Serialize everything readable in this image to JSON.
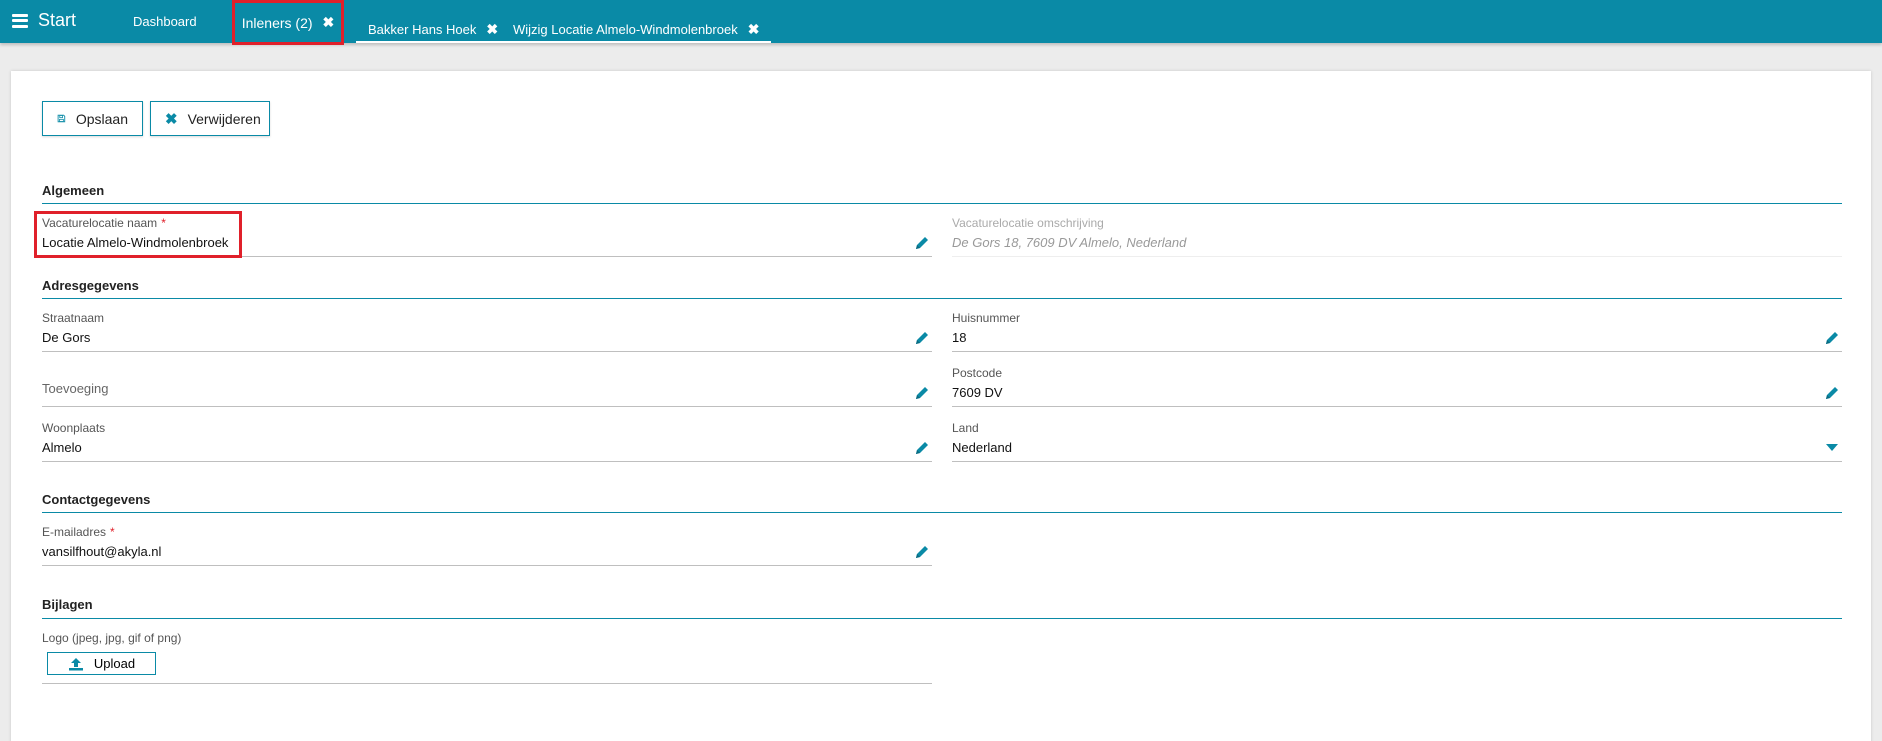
{
  "topbar": {
    "start_label": "Start",
    "tabs": [
      {
        "label": "Dashboard",
        "closable": false
      },
      {
        "label": "Inleners (2)",
        "closable": true
      },
      {
        "label": "Bakker Hans Hoek",
        "closable": true
      },
      {
        "label": "Wijzig Locatie Almelo-Windmolenbroek",
        "closable": true
      }
    ],
    "close_glyph": "✖"
  },
  "toolbar": {
    "save_label": "Opslaan",
    "delete_label": "Verwijderen"
  },
  "sections": {
    "algemeen": "Algemeen",
    "adres": "Adresgegevens",
    "contact": "Contactgegevens",
    "bijlagen": "Bijlagen"
  },
  "fields": {
    "naam": {
      "label": "Vacaturelocatie naam",
      "value": "Locatie Almelo-Windmolenbroek",
      "required": "*"
    },
    "omschrijving": {
      "label": "Vacaturelocatie omschrijving",
      "value": "De Gors 18, 7609 DV Almelo, Nederland"
    },
    "straatnaam": {
      "label": "Straatnaam",
      "value": "De Gors"
    },
    "huisnummer": {
      "label": "Huisnummer",
      "value": "18"
    },
    "toevoeging": {
      "label": "Toevoeging",
      "value": ""
    },
    "postcode": {
      "label": "Postcode",
      "value": "7609 DV"
    },
    "woonplaats": {
      "label": "Woonplaats",
      "value": "Almelo"
    },
    "land": {
      "label": "Land",
      "value": "Nederland"
    },
    "email": {
      "label": "E-mailadres",
      "value": "vansilfhout@akyla.nl",
      "required": "*"
    },
    "logo": {
      "label": "Logo (jpeg, jpg, gif of png)",
      "upload_label": "Upload"
    }
  },
  "colors": {
    "accent": "#0a8aa6",
    "highlight": "#e0202a"
  }
}
